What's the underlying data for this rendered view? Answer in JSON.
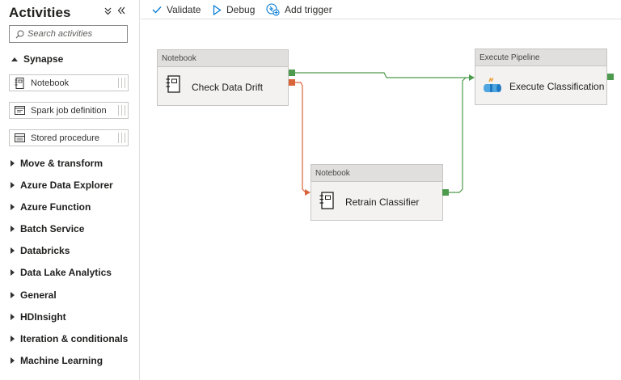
{
  "sidebar": {
    "title": "Activities",
    "collapse_glyph": "»",
    "expand_glyph": "«",
    "search": {
      "placeholder": "Search activities"
    },
    "expanded_group": "Synapse",
    "synapse_items": [
      "Notebook",
      "Spark job definition",
      "Stored procedure"
    ],
    "groups": [
      "Move & transform",
      "Azure Data Explorer",
      "Azure Function",
      "Batch Service",
      "Databricks",
      "Data Lake Analytics",
      "General",
      "HDInsight",
      "Iteration & conditionals",
      "Machine Learning"
    ]
  },
  "toolbar": {
    "validate": "Validate",
    "debug": "Debug",
    "add_trigger": "Add trigger"
  },
  "nodes": {
    "check": {
      "type": "Notebook",
      "name": "Check Data Drift",
      "icon": "notebook-icon"
    },
    "retrain": {
      "type": "Notebook",
      "name": "Retrain Classifier",
      "icon": "notebook-icon"
    },
    "execute": {
      "type": "Execute Pipeline",
      "name": "Execute Classification",
      "icon": "execute-pipeline-icon"
    }
  },
  "colors": {
    "success": "#4e9a4e",
    "failure": "#d9643a",
    "accent": "#0078d4"
  }
}
